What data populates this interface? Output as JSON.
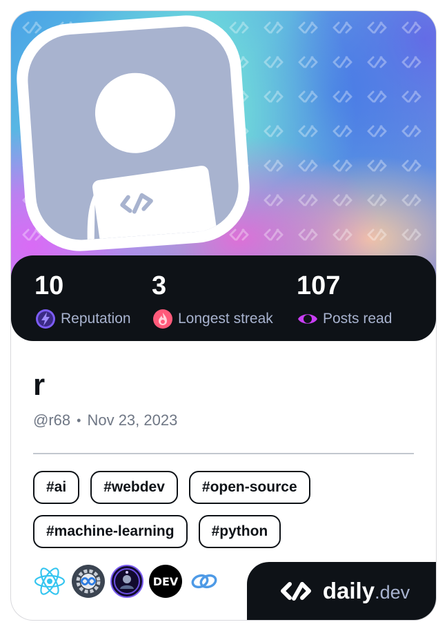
{
  "stats": [
    {
      "value": "10",
      "label": "Reputation",
      "icon": "reputation-bolt-icon",
      "color": "#7c5cf5"
    },
    {
      "value": "3",
      "label": "Longest streak",
      "icon": "streak-flame-icon",
      "color": "#ff5a7a"
    },
    {
      "value": "107",
      "label": "Posts read",
      "icon": "posts-read-icon",
      "color": "#c93ef4"
    }
  ],
  "profile": {
    "name": "r",
    "handle": "@r68",
    "separator": "•",
    "joined": "Nov 23, 2023"
  },
  "tags": [
    "#ai",
    "#webdev",
    "#open-source",
    "#machine-learning",
    "#python"
  ],
  "stack": [
    {
      "icon": "react-icon"
    },
    {
      "icon": "devops-infinity-icon"
    },
    {
      "icon": "community-badge-icon"
    },
    {
      "icon": "dev-logo-icon",
      "text": "DEV"
    },
    {
      "icon": "chain-link-icon"
    }
  ],
  "brand": {
    "name": "daily",
    "suffix": ".dev"
  },
  "colors": {
    "dark": "#0e1217",
    "muted": "#a8b3cf",
    "avatar": "#a8b3cf"
  }
}
